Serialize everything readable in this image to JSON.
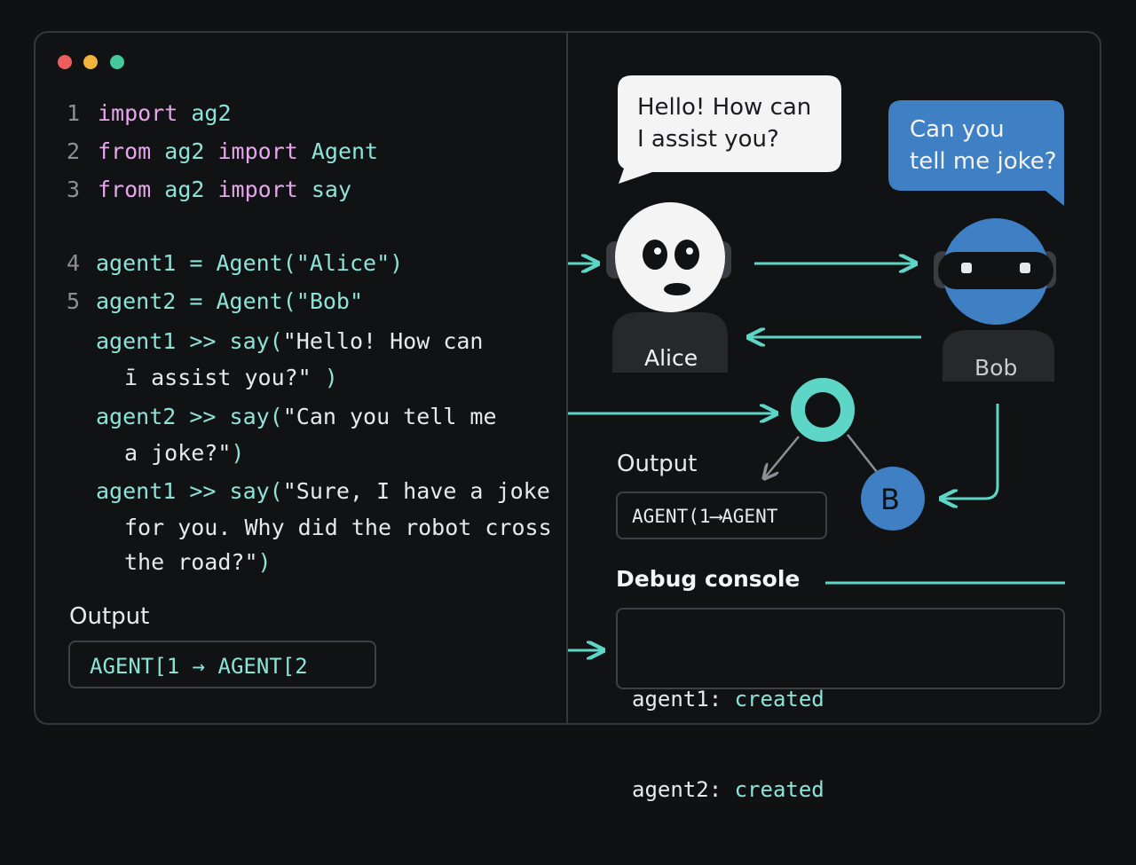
{
  "code": {
    "lines": [
      {
        "num": "1",
        "parts": [
          {
            "t": "import ",
            "c": "kw"
          },
          {
            "t": "ag2",
            "c": "tl"
          }
        ]
      },
      {
        "num": "2",
        "parts": [
          {
            "t": "from ",
            "c": "kw"
          },
          {
            "t": "ag2 ",
            "c": "tl"
          },
          {
            "t": "import ",
            "c": "kw"
          },
          {
            "t": "Agent",
            "c": "tl"
          }
        ]
      },
      {
        "num": "3",
        "parts": [
          {
            "t": "from ",
            "c": "kw"
          },
          {
            "t": "ag2 ",
            "c": "tl"
          },
          {
            "t": "import ",
            "c": "kw"
          },
          {
            "t": "say",
            "c": "tl"
          }
        ]
      },
      {
        "num": "4",
        "parts": [
          {
            "t": "agent1 = Agent(\"Alice\")",
            "c": "tl"
          }
        ]
      },
      {
        "num": "5",
        "parts": [
          {
            "t": "agent2 = Agent(\"Bob\"",
            "c": "tl"
          }
        ]
      },
      {
        "num": "",
        "parts": [
          {
            "t": "agent1 >> say(",
            "c": "tl"
          },
          {
            "t": "\"Hello! How can",
            "c": "wh"
          }
        ]
      },
      {
        "num": "",
        "parts": [
          {
            "t": "ī assist you?\"",
            "c": "wh"
          },
          {
            "t": " )",
            "c": "tl"
          }
        ]
      },
      {
        "num": "",
        "parts": [
          {
            "t": "agent2 >> say(",
            "c": "tl"
          },
          {
            "t": "\"Can you tell me",
            "c": "wh"
          }
        ]
      },
      {
        "num": "",
        "parts": [
          {
            "t": "a joke?\"",
            "c": "wh"
          },
          {
            "t": ")",
            "c": "tl"
          }
        ]
      },
      {
        "num": "",
        "parts": [
          {
            "t": "agent1 >> say(",
            "c": "tl"
          },
          {
            "t": "\"Sure, I have a joke",
            "c": "wh"
          }
        ]
      },
      {
        "num": "",
        "parts": [
          {
            "t": "for you. Why did the robot cross",
            "c": "wh"
          }
        ]
      },
      {
        "num": "",
        "parts": [
          {
            "t": "the road?\"",
            "c": "wh"
          },
          {
            "t": ")",
            "c": "tl"
          }
        ]
      }
    ]
  },
  "left_output": {
    "label": "Output",
    "value": "AGENT[1 → AGENT[2"
  },
  "diagram": {
    "alice_bubble": [
      "Hello! How can",
      "I assist you?"
    ],
    "bob_bubble": [
      "Can you",
      "tell me joke?"
    ],
    "alice_name": "Alice",
    "bob_name": "Bob",
    "node_b_letter": "B",
    "output_label": "Output",
    "output_value": "AGENT(1⟶AGENT"
  },
  "debug": {
    "title": "Debug console",
    "lines": [
      {
        "key": "agent1:",
        "val": "created"
      },
      {
        "key": "agent2:",
        "val": "created"
      }
    ]
  },
  "colors": {
    "accent_teal": "#5dd6c8",
    "bob_blue": "#3f7fc4",
    "window_bg": "#111214"
  }
}
